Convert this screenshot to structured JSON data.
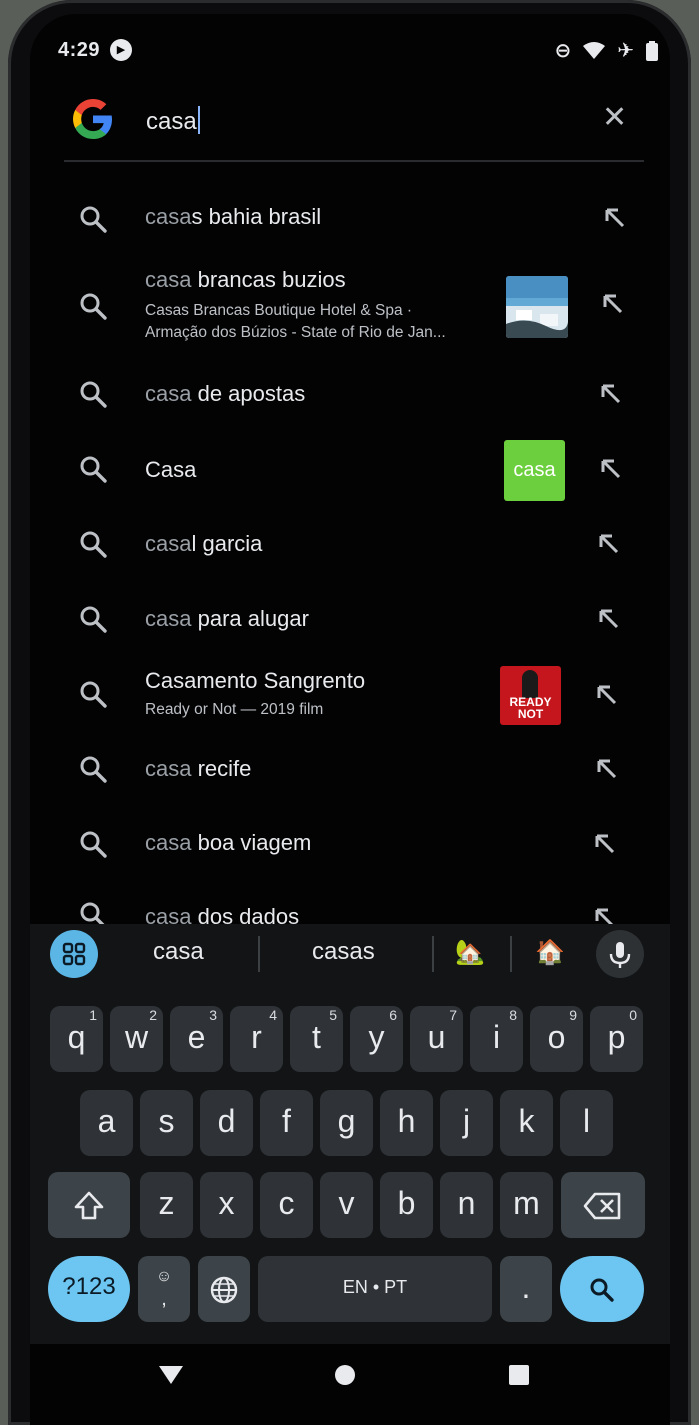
{
  "status": {
    "time": "4:29",
    "icons": [
      "media-play-icon",
      "dnd-icon",
      "wifi-icon",
      "airplane-icon",
      "battery-icon"
    ]
  },
  "search": {
    "query": "casa",
    "logo": "google-g-logo",
    "clear_icon": "close-icon"
  },
  "suggestions": [
    {
      "prefix": "casa",
      "rest": "s bahia brasil"
    },
    {
      "prefix": "casa",
      "rest": " brancas buzios",
      "line1": "Casas Brancas Boutique Hotel & Spa ·",
      "line2": "Armação dos Búzios - State of Rio de Jan...",
      "thumb": "beach-hotel-photo"
    },
    {
      "prefix": "casa",
      "rest": " de apostas"
    },
    {
      "prefix": "",
      "rest": "Casa",
      "thumb_text": "casa",
      "thumb_color": "#6ccf3e"
    },
    {
      "prefix": "casa",
      "rest": "l garcia"
    },
    {
      "prefix": "casa",
      "rest": " para alugar"
    },
    {
      "prefix": "",
      "rest": "Casamento Sangrento",
      "line1": "Ready or Not — 2019 film",
      "thumb": "movie-poster",
      "thumb_text_a": "READY",
      "thumb_text_b": "NOT"
    },
    {
      "prefix": "casa",
      "rest": " recife"
    },
    {
      "prefix": "casa",
      "rest": " boa viagem"
    },
    {
      "prefix": "casa",
      "rest": " dos dados"
    }
  ],
  "keyboard": {
    "suggestions": [
      "casa",
      "casas"
    ],
    "emoji": [
      "house-with-garden-emoji",
      "house-emoji"
    ],
    "row1": [
      {
        "k": "q",
        "n": "1"
      },
      {
        "k": "w",
        "n": "2"
      },
      {
        "k": "e",
        "n": "3"
      },
      {
        "k": "r",
        "n": "4"
      },
      {
        "k": "t",
        "n": "5"
      },
      {
        "k": "y",
        "n": "6"
      },
      {
        "k": "u",
        "n": "7"
      },
      {
        "k": "i",
        "n": "8"
      },
      {
        "k": "o",
        "n": "9"
      },
      {
        "k": "p",
        "n": "0"
      }
    ],
    "row2": [
      "a",
      "s",
      "d",
      "f",
      "g",
      "h",
      "j",
      "k",
      "l"
    ],
    "row3": [
      "z",
      "x",
      "c",
      "v",
      "b",
      "n",
      "m"
    ],
    "symbols_label": "?123",
    "emoji_comma": ",",
    "space_label": "EN • PT",
    "period": ".",
    "colors": {
      "accent": "#6dc6f2",
      "key": "#2f3337",
      "background": "#121416"
    }
  },
  "nav": [
    "back-icon",
    "home-icon",
    "recents-icon"
  ]
}
